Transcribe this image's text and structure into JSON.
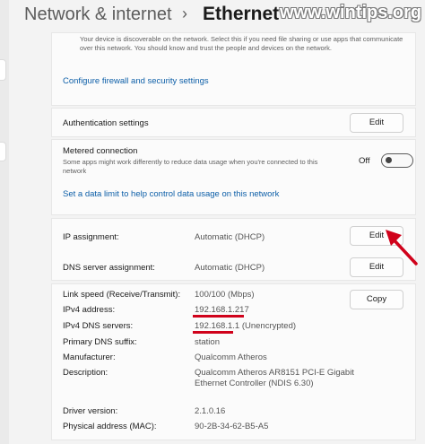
{
  "header": {
    "parent_title": "Network & internet",
    "separator": "›",
    "page_title": "Ethernet",
    "watermark": "www.wintips.org"
  },
  "discovery": {
    "description": "Your device is discoverable on the network. Select this if you need file sharing or use apps that communicate over this network. You should know and trust the people and devices on the network.",
    "firewall_link": "Configure firewall and security settings"
  },
  "authentication": {
    "label": "Authentication settings",
    "button": "Edit"
  },
  "metered": {
    "label": "Metered connection",
    "description": "Some apps might work differently to reduce data usage when you're connected to this network",
    "toggle_state": "Off",
    "link": "Set a data limit to help control data usage on this network"
  },
  "ip": {
    "assignment_label": "IP assignment:",
    "assignment_value": "Automatic (DHCP)",
    "assignment_button": "Edit",
    "dns_label": "DNS server assignment:",
    "dns_value": "Automatic (DHCP)",
    "dns_button": "Edit"
  },
  "properties": {
    "copy_button": "Copy",
    "rows": [
      {
        "label": "Link speed (Receive/Transmit):",
        "value": "100/100 (Mbps)"
      },
      {
        "label": "IPv4 address:",
        "value": "192.168.1.217"
      },
      {
        "label": "IPv4 DNS servers:",
        "value": "192.168.1.1 (Unencrypted)"
      },
      {
        "label": "Primary DNS suffix:",
        "value": "station"
      },
      {
        "label": "Manufacturer:",
        "value": "Qualcomm Atheros"
      },
      {
        "label": "Description:",
        "value": "Qualcomm Atheros AR8151 PCI-E Gigabit Ethernet Controller (NDIS 6.30)"
      },
      {
        "label": "Driver version:",
        "value": "2.1.0.16"
      },
      {
        "label": "Physical address (MAC):",
        "value": "90-2B-34-62-B5-A5"
      }
    ]
  },
  "colors": {
    "accent_link": "#0d5fa8",
    "highlight_red": "#d0021b"
  }
}
